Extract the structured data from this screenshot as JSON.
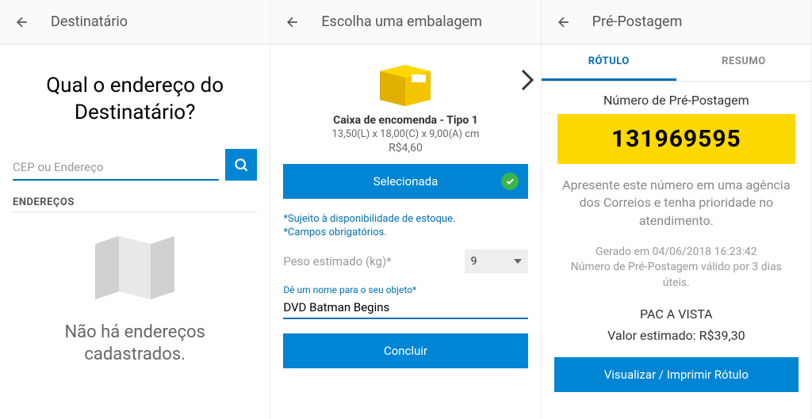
{
  "screen1": {
    "title": "Destinatário",
    "question": "Qual o endereço do Destinatário?",
    "search_placeholder": "CEP ou Endereço",
    "section_label": "ENDEREÇOS",
    "empty_msg": "Não há endereços cadastrados."
  },
  "screen2": {
    "title": "Escolha uma embalagem",
    "box_name": "Caixa de encomenda - Tipo 1",
    "box_dims": "13,50(L) x 18,00(C) x 9,00(A) cm",
    "box_price": "R$4,60",
    "selected_label": "Selecionada",
    "note1": "*Sujeito à disponibilidade de estoque.",
    "note2": "*Campos obrigatórios.",
    "weight_label": "Peso estimado (kg)*",
    "weight_value": "9",
    "name_label": "Dê um nome para o seu objeto*",
    "name_value": "DVD Batman Begins",
    "concluir_label": "Concluir"
  },
  "screen3": {
    "title": "Pré-Postagem",
    "tab1": "RÓTULO",
    "tab2": "RESUMO",
    "pp_label": "Número de Pré-Postagem",
    "pp_number": "131969595",
    "pp_desc": "Apresente este número em uma agência dos Correios e tenha prioridade no atendimento.",
    "pp_date": "Gerado em 04/06/2018 16:23:42",
    "pp_valid": "Número de Pré-Postagem válido por 3 dias úteis.",
    "pp_service": "PAC A VISTA",
    "pp_value": "Valor estimado: R$39,30",
    "print_label": "Visualizar / Imprimir Rótulo"
  }
}
